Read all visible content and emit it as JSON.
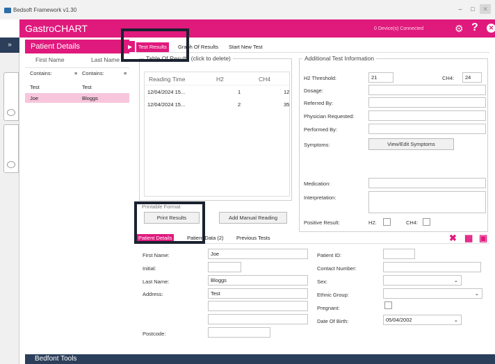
{
  "window": {
    "title": "Bedsoft Framework v1.30"
  },
  "appbar": {
    "brand": "GastroCHART",
    "devices": "0 Device(s) Connected"
  },
  "patient_panel": {
    "title": "Patient Details",
    "columns": [
      "First Name",
      "Last Name"
    ],
    "filters": [
      "Contains:",
      "Contains:"
    ],
    "rows": [
      {
        "first": "Test",
        "last": "Test",
        "selected": false
      },
      {
        "first": "Joe",
        "last": "Bloggs",
        "selected": true
      }
    ]
  },
  "tabs": [
    "Test Results",
    "Graph Of Results",
    "Start New Test"
  ],
  "results": {
    "legend": "Table Of Results (click to delete)",
    "columns": [
      "Reading Time",
      "H2",
      "CH4"
    ],
    "rows": [
      {
        "time": "12/04/2024 15...",
        "h2": "1",
        "ch4": "12"
      },
      {
        "time": "12/04/2024 15...",
        "h2": "2",
        "ch4": "35"
      }
    ],
    "print_button": "Print Results",
    "manual_button": "Add Manual Reading",
    "print_legend": "Printable Format"
  },
  "additional": {
    "legend": "Additional Test Information",
    "h2_threshold_label": "H2 Threshold:",
    "h2_threshold_value": "21",
    "ch4_label": "CH4:",
    "ch4_value": "24",
    "dosage_label": "Dosage:",
    "referred_label": "Referred By:",
    "physician_label": "Physician Requested:",
    "performed_label": "Performed By:",
    "symptoms_label": "Symptoms:",
    "symptoms_button": "View/Edit Symptoms",
    "medication_label": "Medication:",
    "interpretation_label": "Interpretation:",
    "positive_label": "Positive Result:",
    "positive_h2": "H2:",
    "positive_ch4": "CH4:"
  },
  "lower_tabs": [
    "Patient Details",
    "Patient Data (2)",
    "Previous Tests"
  ],
  "details": {
    "first_name_label": "First Name:",
    "first_name": "Joe",
    "initial_label": "Initial:",
    "initial": "",
    "last_name_label": "Last Name:",
    "last_name": "Bloggs",
    "address_label": "Address:",
    "address1": "Test",
    "postcode_label": "Postcode:",
    "patient_id_label": "Patient ID:",
    "contact_label": "Contact Number:",
    "sex_label": "Sex:",
    "ethnic_label": "Ethnic Group:",
    "pregnant_label": "Pregnant:",
    "dob_label": "Date Of Birth:",
    "dob": "05/04/2002"
  },
  "bottom_bar": {
    "title": "Bedfont Tools"
  },
  "colors": {
    "accent": "#e0197d",
    "navy": "#2b3e5a",
    "highlight_box": "#1a2230"
  },
  "icons": [
    "app-icon",
    "gear-icon",
    "help-icon",
    "close-icon",
    "pin-icon",
    "delete-icon",
    "trash-icon",
    "save-icon"
  ]
}
